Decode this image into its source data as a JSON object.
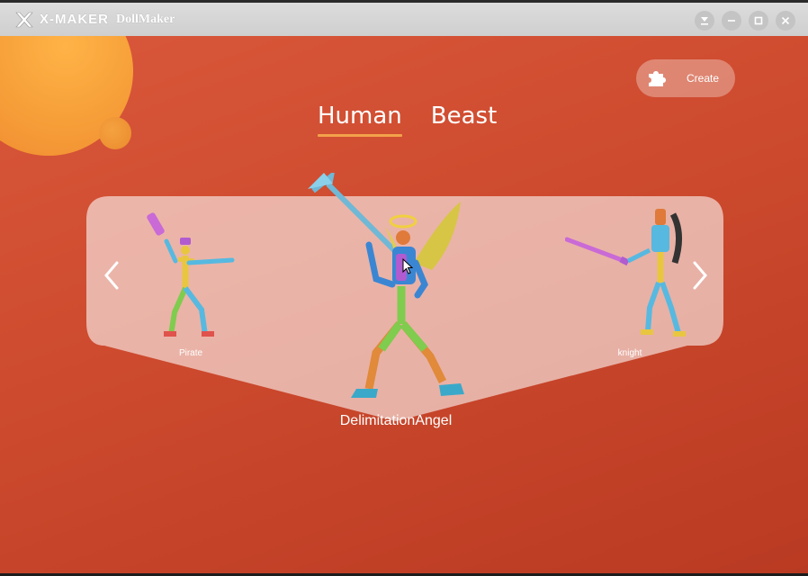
{
  "window": {
    "brand": "X-MAKER",
    "app_name": "DollMaker"
  },
  "toolbar": {
    "create_label": "Create"
  },
  "tabs": [
    {
      "label": "Human",
      "active": true
    },
    {
      "label": "Beast",
      "active": false
    }
  ],
  "carousel": {
    "items": [
      {
        "label": "Pirate"
      },
      {
        "label": "DelimitationAngel"
      },
      {
        "label": "knight"
      }
    ]
  },
  "colors": {
    "accent": "#f3a24a",
    "background": "#cd4a2e"
  }
}
